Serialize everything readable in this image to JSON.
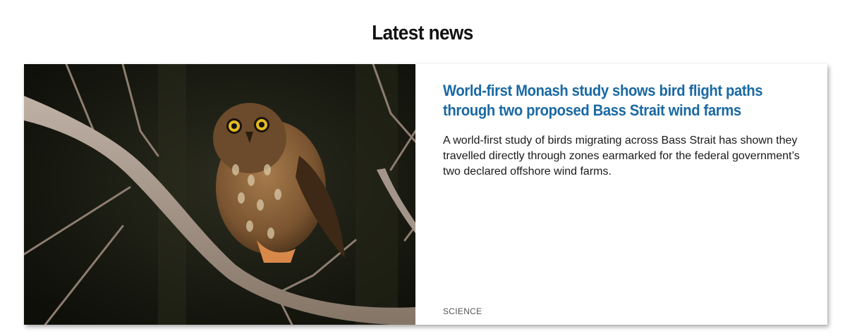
{
  "section": {
    "title": "Latest news"
  },
  "article": {
    "headline": "World-first Monash study shows bird flight paths\nthrough two proposed Bass Strait wind farms",
    "summary": "A world-first study of birds migrating across Bass Strait has shown they\ntravelled directly through zones earmarked for the federal government’s\ntwo declared offshore wind farms.",
    "category": "SCIENCE",
    "image": "owl-on-branch-photo"
  },
  "colors": {
    "headline": "#1a69a3",
    "text": "#1a1a1a",
    "category": "#555555",
    "background": "#ffffff"
  }
}
